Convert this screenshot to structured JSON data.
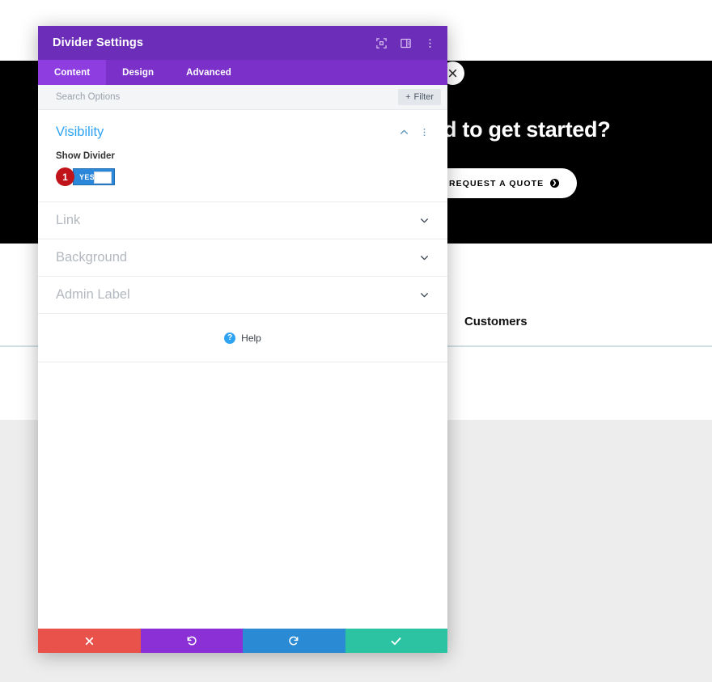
{
  "site": {
    "hero_heading": "d to get started?",
    "quote_button": "REQUEST A QUOTE",
    "section_heading": "Customers",
    "close_icon_name": "close-icon"
  },
  "modal": {
    "title": "Divider Settings",
    "header_icons": [
      {
        "name": "fullscreen-icon",
        "label": "Fullscreen"
      },
      {
        "name": "panel-layout-icon",
        "label": "Change Layout"
      },
      {
        "name": "more-vertical-icon",
        "label": "More Options"
      }
    ],
    "tabs": [
      {
        "label": "Content",
        "active": true
      },
      {
        "label": "Design",
        "active": false
      },
      {
        "label": "Advanced",
        "active": false
      }
    ],
    "search": {
      "placeholder": "Search Options",
      "value": ""
    },
    "filter_button": "Filter",
    "filter_plus": "+",
    "sections": {
      "visibility": {
        "title": "Visibility",
        "collapse_icon": "chevron-up-icon",
        "menu_icon": "more-vertical-icon",
        "field_label": "Show Divider",
        "toggle_value": "YES",
        "toggle_on": true,
        "badge": "1"
      },
      "collapsed": [
        {
          "title": "Link",
          "icon": "chevron-down-icon"
        },
        {
          "title": "Background",
          "icon": "chevron-down-icon"
        },
        {
          "title": "Admin Label",
          "icon": "chevron-down-icon"
        }
      ]
    },
    "help": {
      "label": "Help",
      "icon_glyph": "?"
    },
    "footer_buttons": [
      {
        "name": "cancel-button",
        "icon": "close-icon",
        "color": "#e8524a"
      },
      {
        "name": "undo-button",
        "icon": "undo-icon",
        "color": "#8b2fd6"
      },
      {
        "name": "redo-button",
        "icon": "redo-icon",
        "color": "#2a8ad4"
      },
      {
        "name": "save-button",
        "icon": "check-icon",
        "color": "#2bc3a1"
      }
    ]
  },
  "colors": {
    "modal_header": "#6c2eb9",
    "tab_bar": "#7b30c9",
    "tab_active": "#8e3ee0",
    "accent_blue": "#2ea3f2",
    "toggle_on": "#2b87da",
    "badge_red": "#c0131a",
    "divider_line": "#cfe0e0"
  }
}
